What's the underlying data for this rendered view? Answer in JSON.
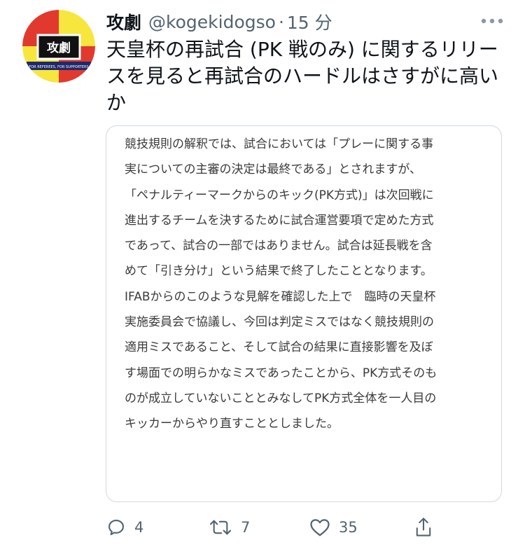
{
  "tweet": {
    "display_name": "攻劇",
    "handle": "@kogekidogso",
    "separator": "·",
    "time": "15 分",
    "text": "天皇杯の再試合 (PK 戦のみ) に関するリリースを見ると再試合のハードルはさすがに高いか"
  },
  "avatar": {
    "icon": "logo-icon",
    "title": "攻劇",
    "tagline": "FOR REFEREES, FOR SUPPORTERS",
    "colors": {
      "red": "#e2392f",
      "yellow": "#f7e63e",
      "navy": "#1d2a6b"
    }
  },
  "quote": {
    "lines": [
      "競技規則の解釈では、試合においては「プレーに関する事",
      "実についての主審の決定は最終である」とされますが、",
      "「ペナルティーマークからのキック(PK方式)」は次回戦に",
      "進出するチームを決するために試合運営要項で定めた方式",
      "であって、試合の一部ではありません。試合は延長戦を含",
      "めて「引き分け」という結果で終了したこととなります。",
      "IFABからのこのような見解を確認した上で　臨時の天皇杯",
      "実施委員会で協議し、今回は判定ミスではなく競技規則の",
      "適用ミスであること、そして試合の結果に直接影響を及ぼ",
      "す場面での明らかなミスであったことから、PK方式そのも",
      "のが成立していないこととみなしてPK方式全体を一人目の",
      "キッカーからやり直すこととしました。"
    ]
  },
  "actions": {
    "reply": {
      "icon": "reply-icon",
      "count": "4"
    },
    "retweet": {
      "icon": "retweet-icon",
      "count": "7"
    },
    "like": {
      "icon": "heart-icon",
      "count": "35"
    },
    "share": {
      "icon": "share-icon"
    }
  },
  "colors": {
    "text_primary": "#0f1419",
    "text_secondary": "#536471",
    "border": "#cfd9de"
  }
}
